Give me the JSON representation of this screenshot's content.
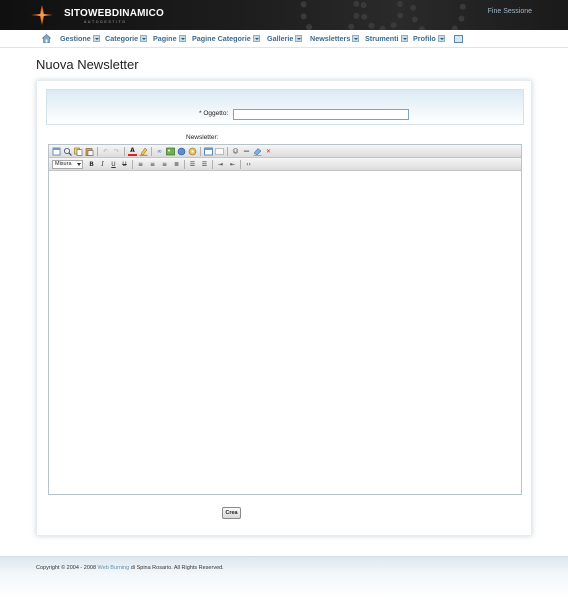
{
  "header": {
    "brand": "SITOWEBDINAMICO",
    "tagline": "AUTOGESTITO",
    "logout_label": "Fine Sessione"
  },
  "nav": {
    "items": [
      {
        "label": "Gestione"
      },
      {
        "label": "Categorie"
      },
      {
        "label": "Pagine"
      },
      {
        "label": "Pagine Categorie"
      },
      {
        "label": "Gallerie"
      },
      {
        "label": "Newsletters"
      },
      {
        "label": "Strumenti"
      },
      {
        "label": "Profilo"
      }
    ]
  },
  "page": {
    "title": "Nuova Newsletter"
  },
  "form": {
    "subject_label": "* Oggetto:",
    "subject_value": "",
    "newsletter_label": "Newsletter:",
    "size_select": "Misura",
    "create_label": "Crea"
  },
  "footer": {
    "prefix": "Copyright © 2004 - 2008",
    "link": "Web Burning",
    "suffix": "di Spina Rosario. All Rights Reserved."
  },
  "colors": {
    "header_bg": "#1a1a1a",
    "nav_link": "#3d6c8c",
    "accent": "#7ba3c4"
  }
}
